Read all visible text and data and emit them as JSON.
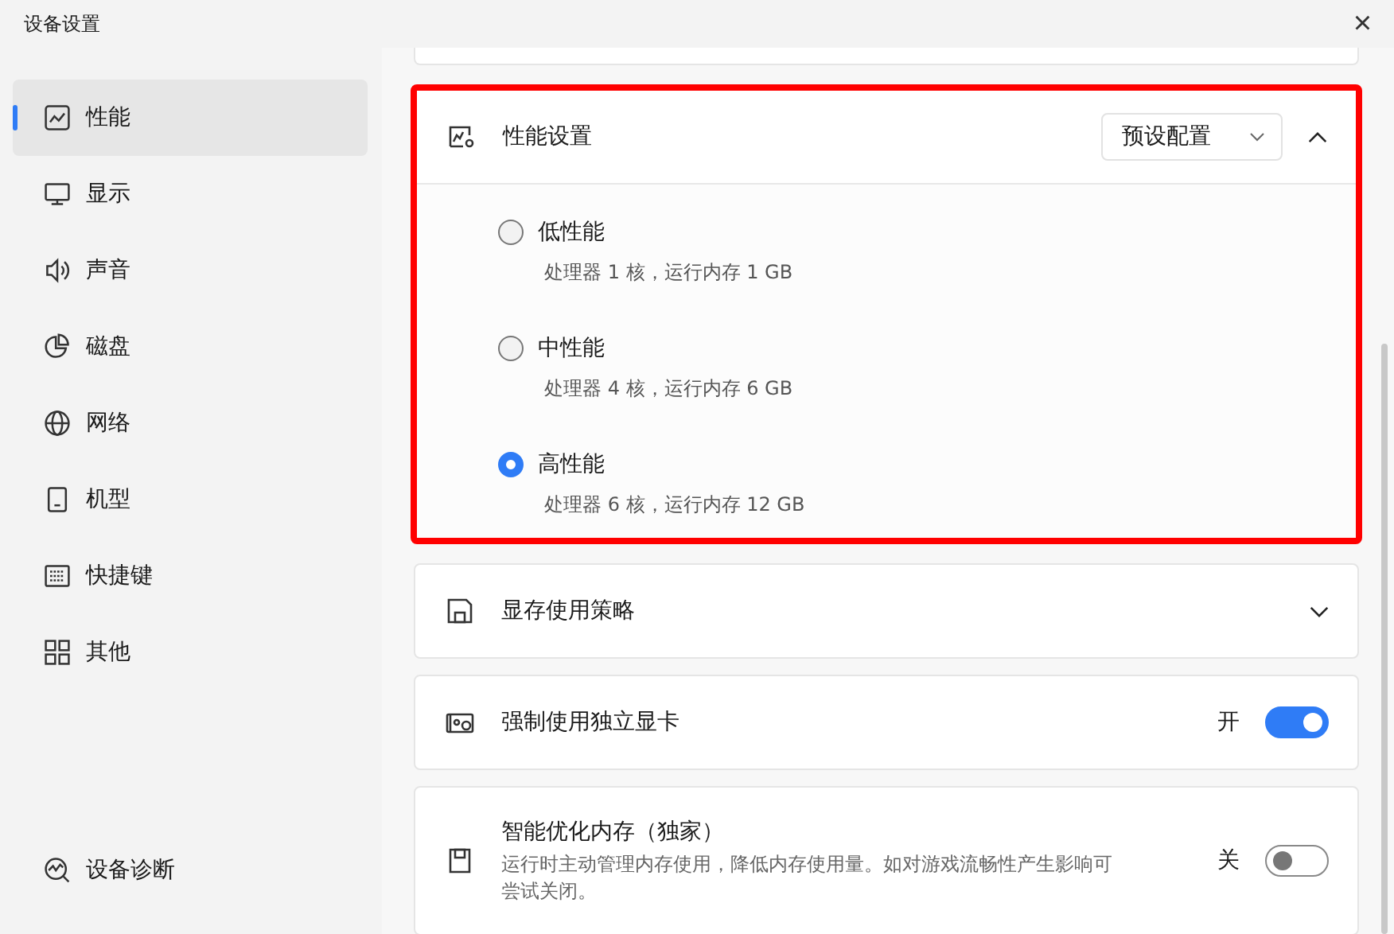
{
  "window": {
    "title": "设备设置",
    "close": "×"
  },
  "sidebar": {
    "items": [
      {
        "label": "性能",
        "selected": true
      },
      {
        "label": "显示",
        "selected": false
      },
      {
        "label": "声音",
        "selected": false
      },
      {
        "label": "磁盘",
        "selected": false
      },
      {
        "label": "网络",
        "selected": false
      },
      {
        "label": "机型",
        "selected": false
      },
      {
        "label": "快捷键",
        "selected": false
      },
      {
        "label": "其他",
        "selected": false
      }
    ],
    "footer": {
      "label": "设备诊断"
    }
  },
  "cards": [
    {
      "kind": "options",
      "title": "性能设置",
      "highlighted": true,
      "dropdown": "预设配置",
      "expanded": true,
      "options": [
        {
          "label": "低性能",
          "detail": "处理器 1 核，运行内存 1 GB",
          "selected": false
        },
        {
          "label": "中性能",
          "detail": "处理器 4 核，运行内存 6 GB",
          "selected": false
        },
        {
          "label": "高性能",
          "detail": "处理器 6 核，运行内存 12 GB",
          "selected": true
        }
      ]
    },
    {
      "kind": "collapsible",
      "title": "显存使用策略",
      "expanded": false
    },
    {
      "kind": "toggle",
      "title": "强制使用独立显卡",
      "state_label": "开",
      "on": true
    },
    {
      "kind": "toggle",
      "title": "智能优化内存（独家）",
      "description": "运行时主动管理内存使用，降低内存使用量。如对游戏流畅性产生影响可尝试关闭。",
      "state_label": "关",
      "on": false
    }
  ]
}
